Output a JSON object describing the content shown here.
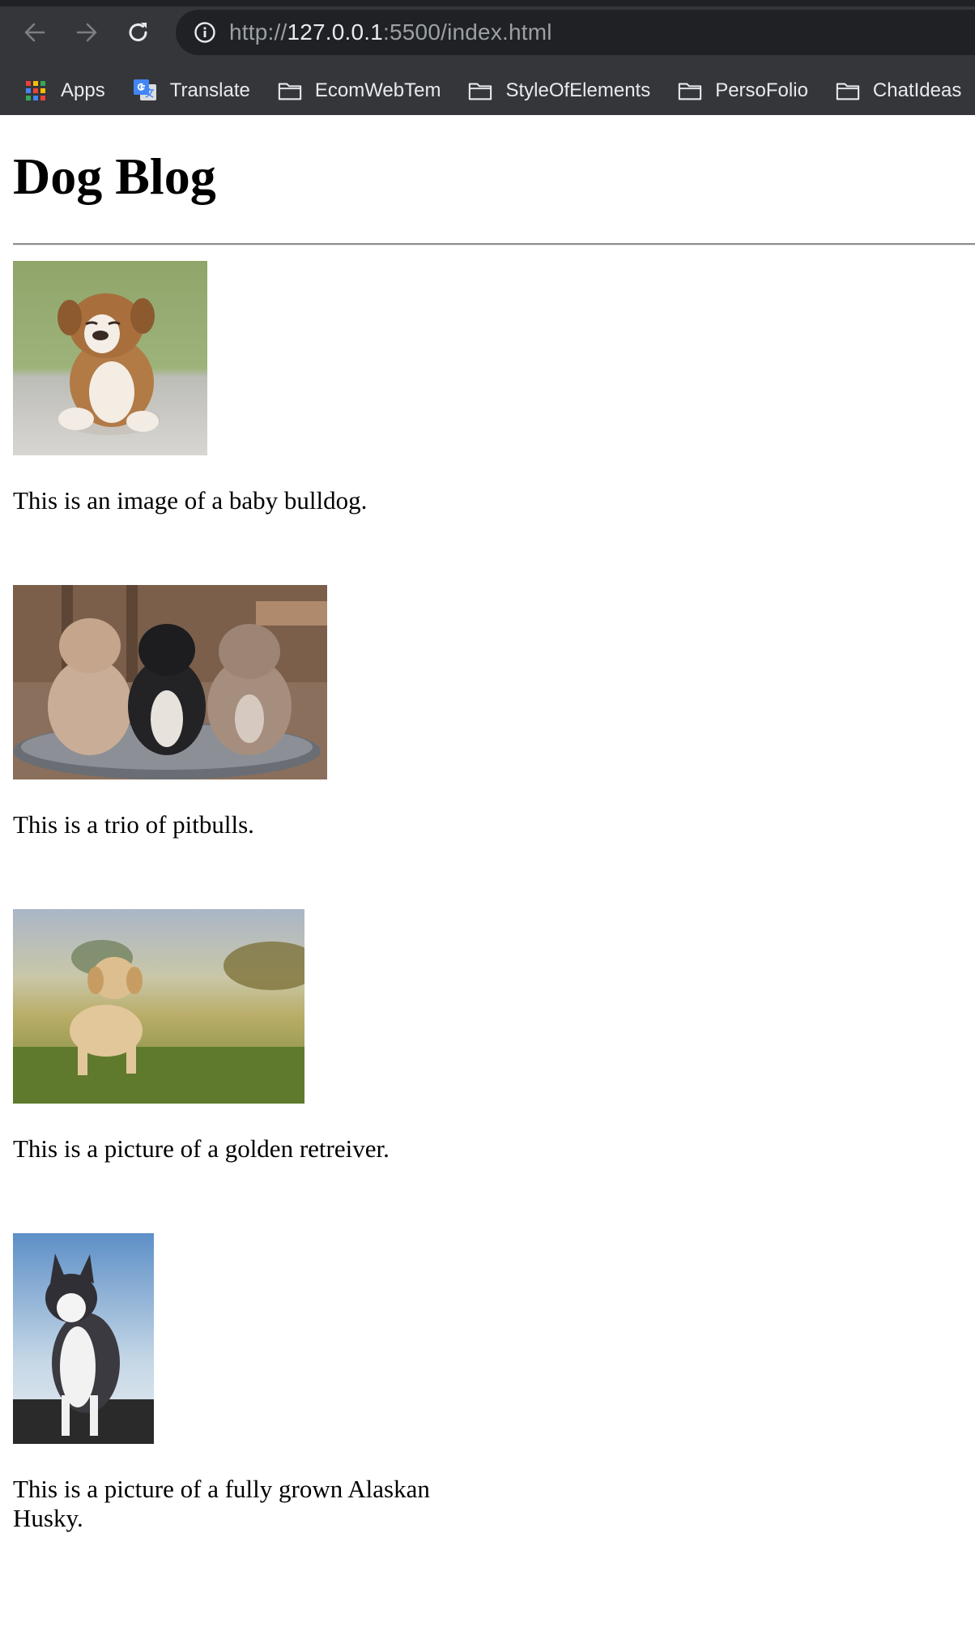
{
  "browser": {
    "url_scheme": "http://",
    "url_host": "127.0.0.1",
    "url_path": ":5500/index.html",
    "bookmarks": [
      {
        "label": "Apps"
      },
      {
        "label": "Translate"
      },
      {
        "label": "EcomWebTem"
      },
      {
        "label": "StyleOfElements"
      },
      {
        "label": "PersoFolio"
      },
      {
        "label": "ChatIdeas"
      }
    ]
  },
  "page": {
    "title": "Dog Blog",
    "posts": [
      {
        "caption": "This is an image of a baby bulldog."
      },
      {
        "caption": "This is a trio of pitbulls."
      },
      {
        "caption": "This is a picture of a golden retreiver."
      },
      {
        "caption": "This is a picture of a fully grown Alaskan Husky."
      }
    ]
  },
  "colors": {
    "chrome_bg": "#35363a",
    "omnibox_bg": "#202124",
    "chrome_text": "#e8eaed",
    "url_dim": "#9aa0a6"
  }
}
